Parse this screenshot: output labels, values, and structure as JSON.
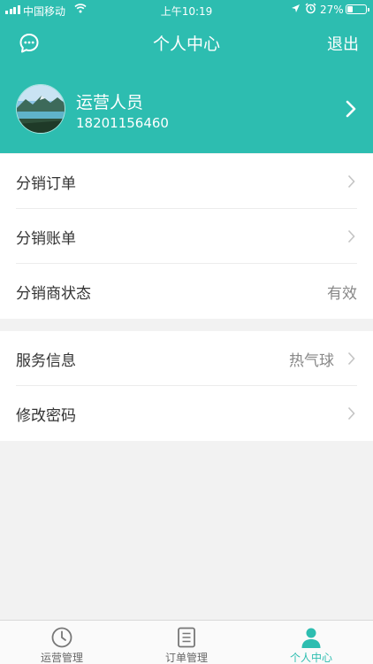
{
  "status_bar": {
    "carrier": "中国移动",
    "time": "上午10:19",
    "battery": "27%",
    "battery_level": 0.27,
    "icons": [
      "signal-icon",
      "wifi-icon",
      "location-icon",
      "alarm-icon",
      "battery-icon"
    ]
  },
  "nav": {
    "title": "个人中心",
    "logout": "退出",
    "left_icon": "chat-icon"
  },
  "profile": {
    "name": "运营人员",
    "phone": "18201156460"
  },
  "menu": {
    "group1": [
      {
        "label": "分销订单",
        "value": "",
        "arrow": true
      },
      {
        "label": "分销账单",
        "value": "",
        "arrow": true
      },
      {
        "label": "分销商状态",
        "value": "有效",
        "arrow": false
      }
    ],
    "group2": [
      {
        "label": "服务信息",
        "value": "热气球",
        "arrow": true
      },
      {
        "label": "修改密码",
        "value": "",
        "arrow": true
      }
    ]
  },
  "tabbar": {
    "tabs": [
      {
        "label": "运营管理",
        "icon": "clock-icon",
        "active": false
      },
      {
        "label": "订单管理",
        "icon": "document-icon",
        "active": false
      },
      {
        "label": "个人中心",
        "icon": "person-icon",
        "active": true
      }
    ]
  },
  "colors": {
    "accent": "#2dbdb0",
    "background": "#f2f2f2"
  }
}
